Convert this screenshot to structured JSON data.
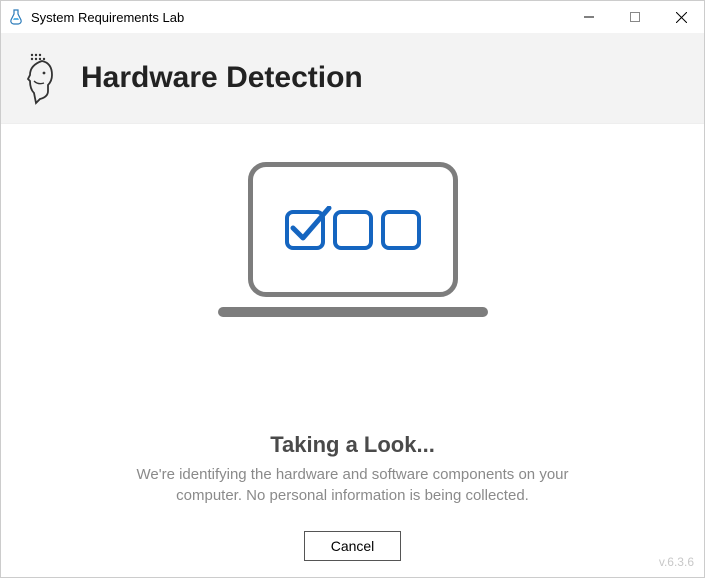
{
  "app": {
    "title": "System Requirements Lab"
  },
  "header": {
    "title": "Hardware Detection"
  },
  "status": {
    "heading": "Taking a Look...",
    "description": "We're identifying the hardware and software components on your computer. No personal information is being collected."
  },
  "footer": {
    "cancel_label": "Cancel",
    "version": "v.6.3.6"
  },
  "icons": {
    "app": "beaker-icon",
    "head": "face-silhouette-icon",
    "illus": "laptop-checklist-icon"
  },
  "colors": {
    "accent": "#1565c0"
  }
}
